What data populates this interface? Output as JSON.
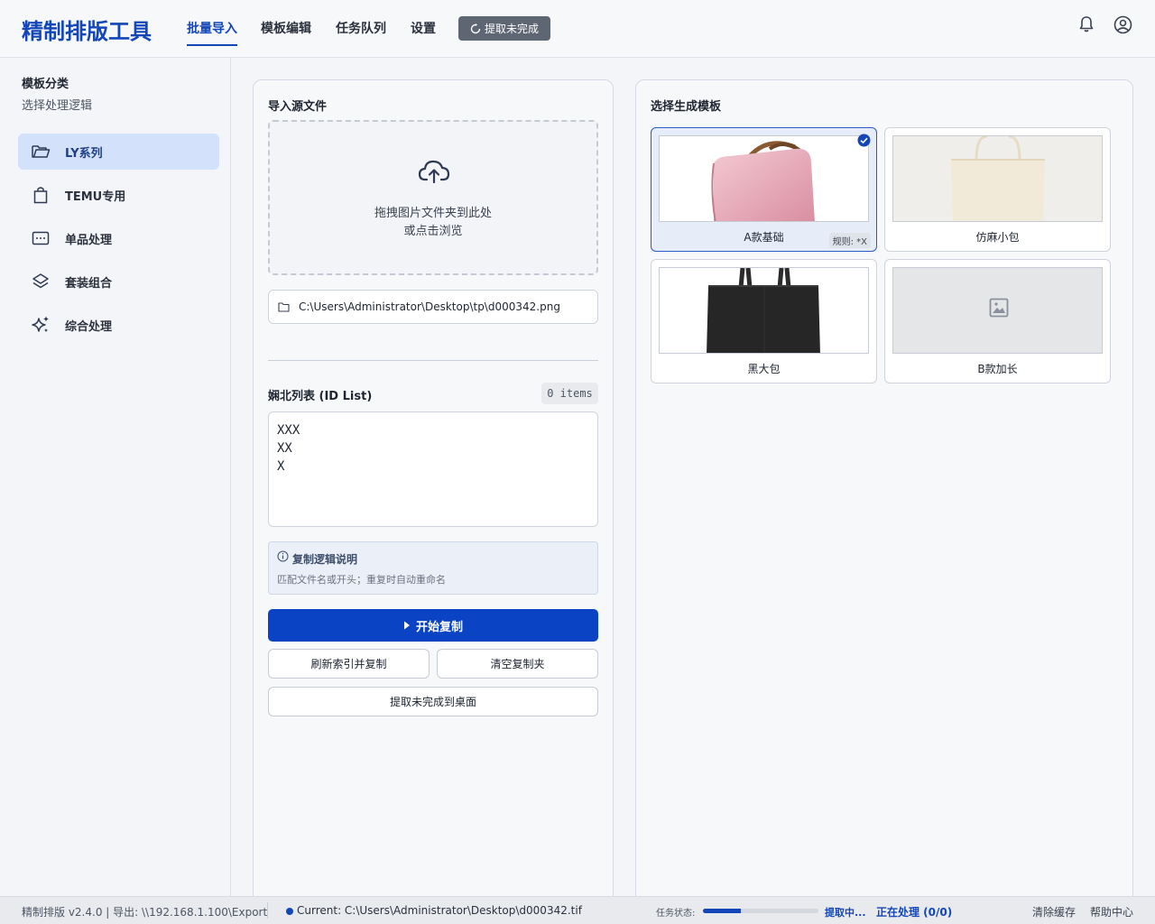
{
  "app": {
    "logo": "精制排版工具",
    "nav": [
      {
        "label": "批量导入",
        "active": true
      },
      {
        "label": "模板编辑",
        "active": false
      },
      {
        "label": "任务队列",
        "active": false
      },
      {
        "label": "设置",
        "active": false
      }
    ],
    "header_button": "提取未完成",
    "icons": {
      "bell": "bell-icon",
      "account": "account-circle-icon"
    }
  },
  "sidebar": {
    "title": "模板分类",
    "subtitle": "选择处理逻辑",
    "items": [
      {
        "label": "LY系列",
        "icon": "folder-open-icon",
        "active": true
      },
      {
        "label": "TEMU专用",
        "icon": "shopping-bag-icon",
        "active": false
      },
      {
        "label": "单品处理",
        "icon": "tag-frame-icon",
        "active": false
      },
      {
        "label": "套装组合",
        "icon": "layers-icon",
        "active": false
      },
      {
        "label": "综合处理",
        "icon": "sparkle-icon",
        "active": false
      }
    ]
  },
  "import": {
    "title": "导入源文件",
    "drop_line1": "拖拽图片文件夹到此处",
    "drop_line2": "或点击浏览",
    "path": "C:\\Users\\Administrator\\Desktop\\tp\\d000342.png",
    "id_title": "娴北列表 (ID List)",
    "id_count": "0 items",
    "id_lines": [
      "XXX",
      "XX",
      "X"
    ],
    "info_title": "复制逻辑说明",
    "info_desc": "匹配文件名或开头；重复时自动重命名",
    "start_button": "开始复制",
    "refresh_button": "刷新索引并复制",
    "clear_button": "清空复制夹",
    "extract_button": "提取未完成到桌面"
  },
  "templates": {
    "title": "选择生成模板",
    "cards": [
      {
        "label": "A款基础",
        "rule": "规则: *X",
        "selected": true
      },
      {
        "label": "仿麻小包",
        "selected": false
      },
      {
        "label": "黑大包",
        "selected": false
      },
      {
        "label": "B款加长",
        "selected": false
      }
    ]
  },
  "status": {
    "version": "精制排版 v2.4.0 | 导出: \\\\192.168.1.100\\Export",
    "current": "Current: C:\\Users\\Administrator\\Desktop\\d000342.tif",
    "task_label": "任务状态:",
    "progress": 0.33,
    "extracting": "提取中...",
    "processing": "正在处理 (0/0)",
    "clear_cache": "清除缓存",
    "help": "帮助中心"
  }
}
